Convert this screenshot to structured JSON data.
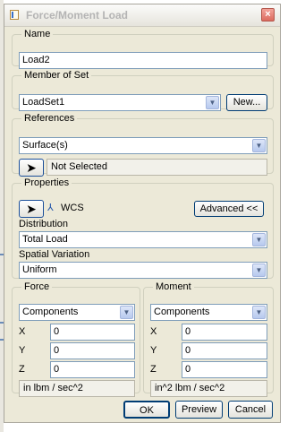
{
  "dialog": {
    "title": "Force/Moment Load",
    "close_glyph": "×"
  },
  "name_group": {
    "legend": "Name",
    "value": "Load2"
  },
  "member_group": {
    "legend": "Member of Set",
    "selected": "LoadSet1",
    "new_label": "New..."
  },
  "references_group": {
    "legend": "References",
    "type": "Surface(s)",
    "selection_status": "Not Selected"
  },
  "properties_group": {
    "legend": "Properties",
    "csys_label": "WCS",
    "advanced_label": "Advanced <<",
    "distribution_label": "Distribution",
    "distribution_value": "Total Load",
    "spatial_label": "Spatial Variation",
    "spatial_value": "Uniform"
  },
  "force_group": {
    "legend": "Force",
    "mode": "Components",
    "x_label": "X",
    "x_value": "0",
    "y_label": "Y",
    "y_value": "0",
    "z_label": "Z",
    "z_value": "0",
    "units": "in lbm / sec^2"
  },
  "moment_group": {
    "legend": "Moment",
    "mode": "Components",
    "x_label": "X",
    "x_value": "0",
    "y_label": "Y",
    "y_value": "0",
    "z_label": "Z",
    "z_value": "0",
    "units": "in^2 lbm / sec^2"
  },
  "footer": {
    "ok_label": "OK",
    "preview_label": "Preview",
    "cancel_label": "Cancel"
  },
  "icons": {
    "pick": "arrow-cursor-icon",
    "combo_arrow": "chevron-down-icon",
    "csys": "coordinate-system-icon"
  }
}
